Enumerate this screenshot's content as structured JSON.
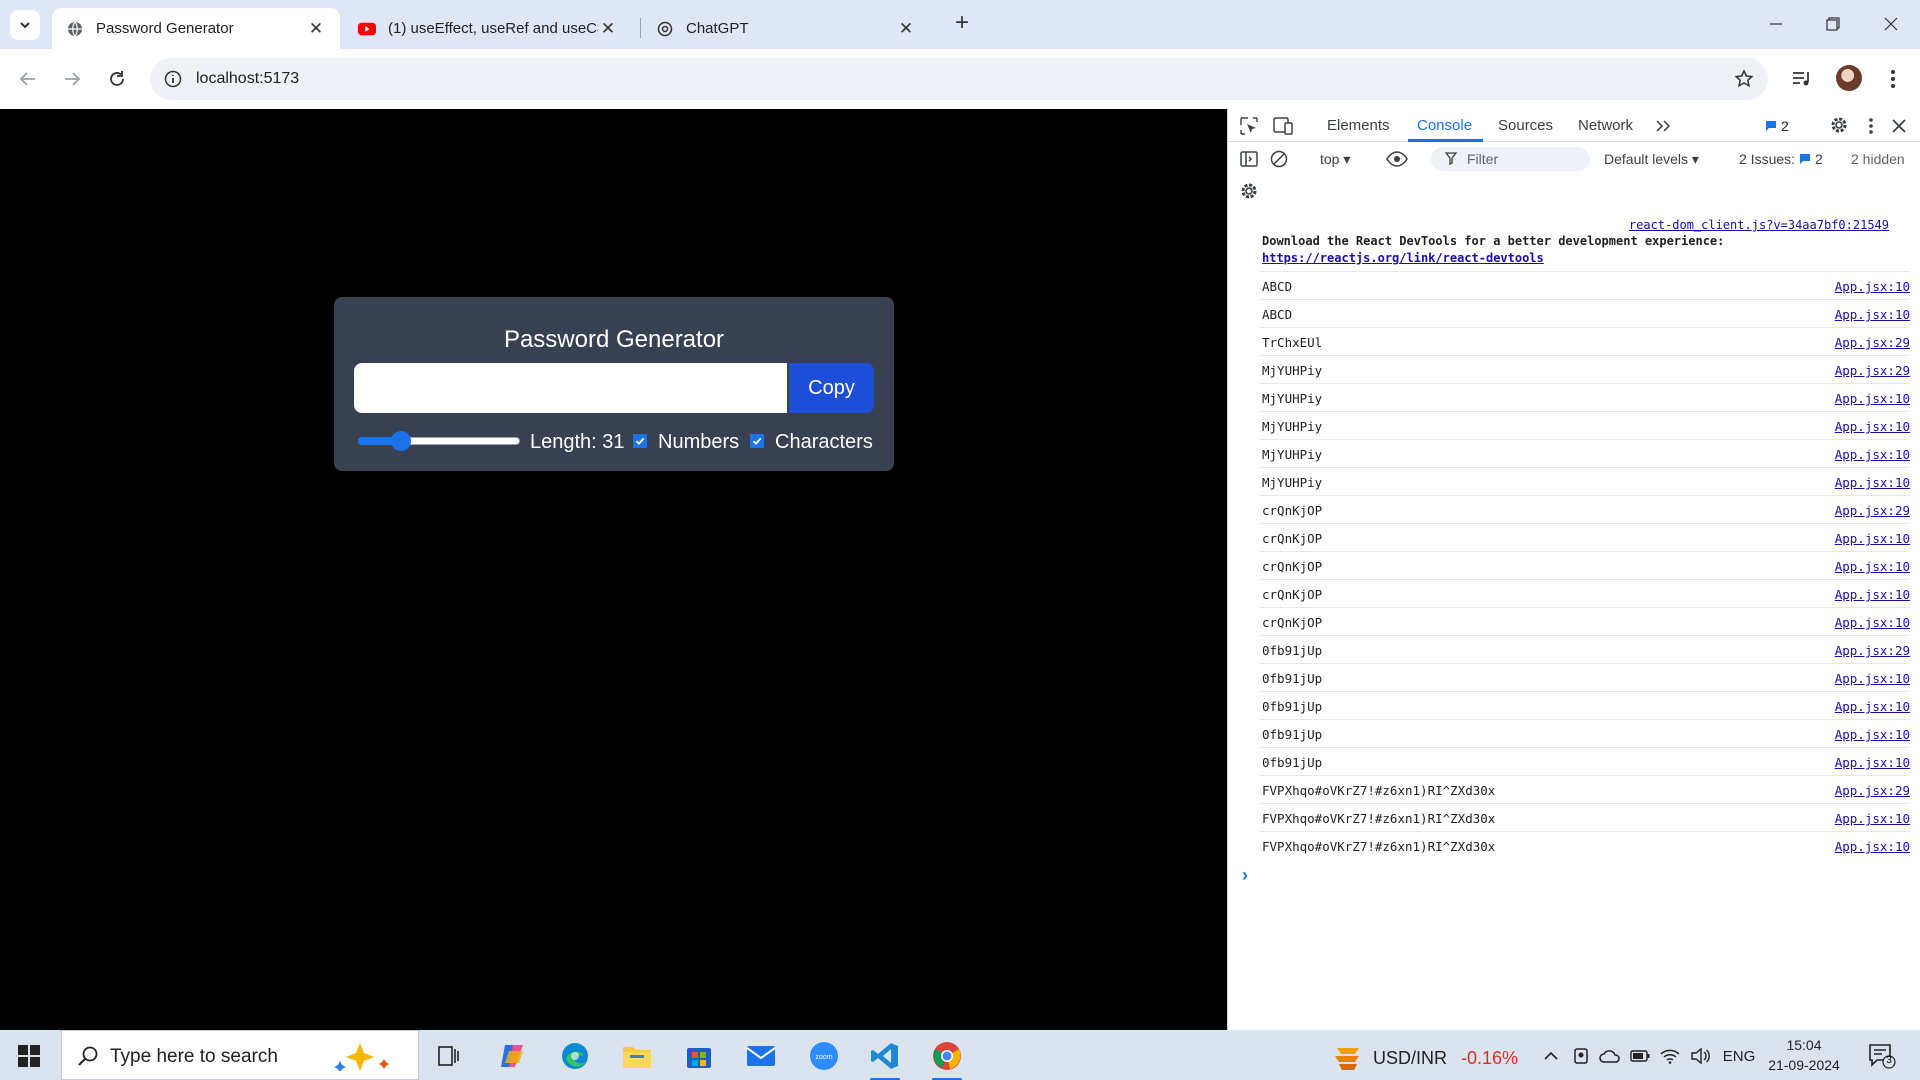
{
  "browser": {
    "tabs": [
      {
        "title": "Password Generator",
        "active": true
      },
      {
        "title": "(1) useEffect, useRef and useCallback",
        "active": false
      },
      {
        "title": "ChatGPT",
        "active": false
      }
    ],
    "url": "localhost:5173"
  },
  "app": {
    "title": "Password Generator",
    "password_value": "",
    "copy_label": "Copy",
    "length": 31,
    "length_min": 6,
    "length_max": 100,
    "length_label": "Length: 31",
    "numbers_label": "Numbers",
    "numbers_checked": true,
    "characters_label": "Characters",
    "characters_checked": true
  },
  "devtools": {
    "tabs": [
      "Elements",
      "Console",
      "Sources",
      "Network"
    ],
    "active_tab": "Console",
    "issues_count": "2",
    "context": "top",
    "filter_placeholder": "Filter",
    "levels_label": "Default levels",
    "issues_label": "2 Issues:",
    "issues_badge": "2",
    "hidden_label": "2 hidden",
    "react_msg": {
      "source": "react-dom_client.js?v=34aa7bf0:21549",
      "text": "Download the React DevTools for a better development experience:",
      "link": "https://reactjs.org/link/react-devtools"
    },
    "logs": [
      {
        "msg": "ABCD",
        "src": "App.jsx:10"
      },
      {
        "msg": "ABCD",
        "src": "App.jsx:10"
      },
      {
        "msg": "TrChxEUl",
        "src": "App.jsx:29"
      },
      {
        "msg": "MjYUHPiy",
        "src": "App.jsx:29"
      },
      {
        "msg": "MjYUHPiy",
        "src": "App.jsx:10"
      },
      {
        "msg": "MjYUHPiy",
        "src": "App.jsx:10"
      },
      {
        "msg": "MjYUHPiy",
        "src": "App.jsx:10"
      },
      {
        "msg": "MjYUHPiy",
        "src": "App.jsx:10"
      },
      {
        "msg": "crQnKjOP",
        "src": "App.jsx:29"
      },
      {
        "msg": "crQnKjOP",
        "src": "App.jsx:10"
      },
      {
        "msg": "crQnKjOP",
        "src": "App.jsx:10"
      },
      {
        "msg": "crQnKjOP",
        "src": "App.jsx:10"
      },
      {
        "msg": "crQnKjOP",
        "src": "App.jsx:10"
      },
      {
        "msg": "0fb91jUp",
        "src": "App.jsx:29"
      },
      {
        "msg": "0fb91jUp",
        "src": "App.jsx:10"
      },
      {
        "msg": "0fb91jUp",
        "src": "App.jsx:10"
      },
      {
        "msg": "0fb91jUp",
        "src": "App.jsx:10"
      },
      {
        "msg": "0fb91jUp",
        "src": "App.jsx:10"
      },
      {
        "msg": "FVPXhqo#oVKrZ7!#z6xn1)RI^ZXd30x",
        "src": "App.jsx:29"
      },
      {
        "msg": "FVPXhqo#oVKrZ7!#z6xn1)RI^ZXd30x",
        "src": "App.jsx:10"
      },
      {
        "msg": "FVPXhqo#oVKrZ7!#z6xn1)RI^ZXd30x",
        "src": "App.jsx:10"
      }
    ]
  },
  "taskbar": {
    "search_placeholder": "Type here to search",
    "ticker_name": "USD/INR",
    "ticker_change": "-0.16%",
    "lang": "ENG",
    "time": "15:04",
    "date": "21-09-2024",
    "notifications": "3"
  },
  "icons": {
    "tab_favicon_1": "globe-icon",
    "tab_favicon_2": "youtube-icon",
    "tab_favicon_3": "chatgpt-icon"
  },
  "colors": {
    "card_bg": "#374151",
    "copy_btn": "#1d4ed8",
    "accent": "#1a73e8",
    "page_bg": "#000000"
  }
}
